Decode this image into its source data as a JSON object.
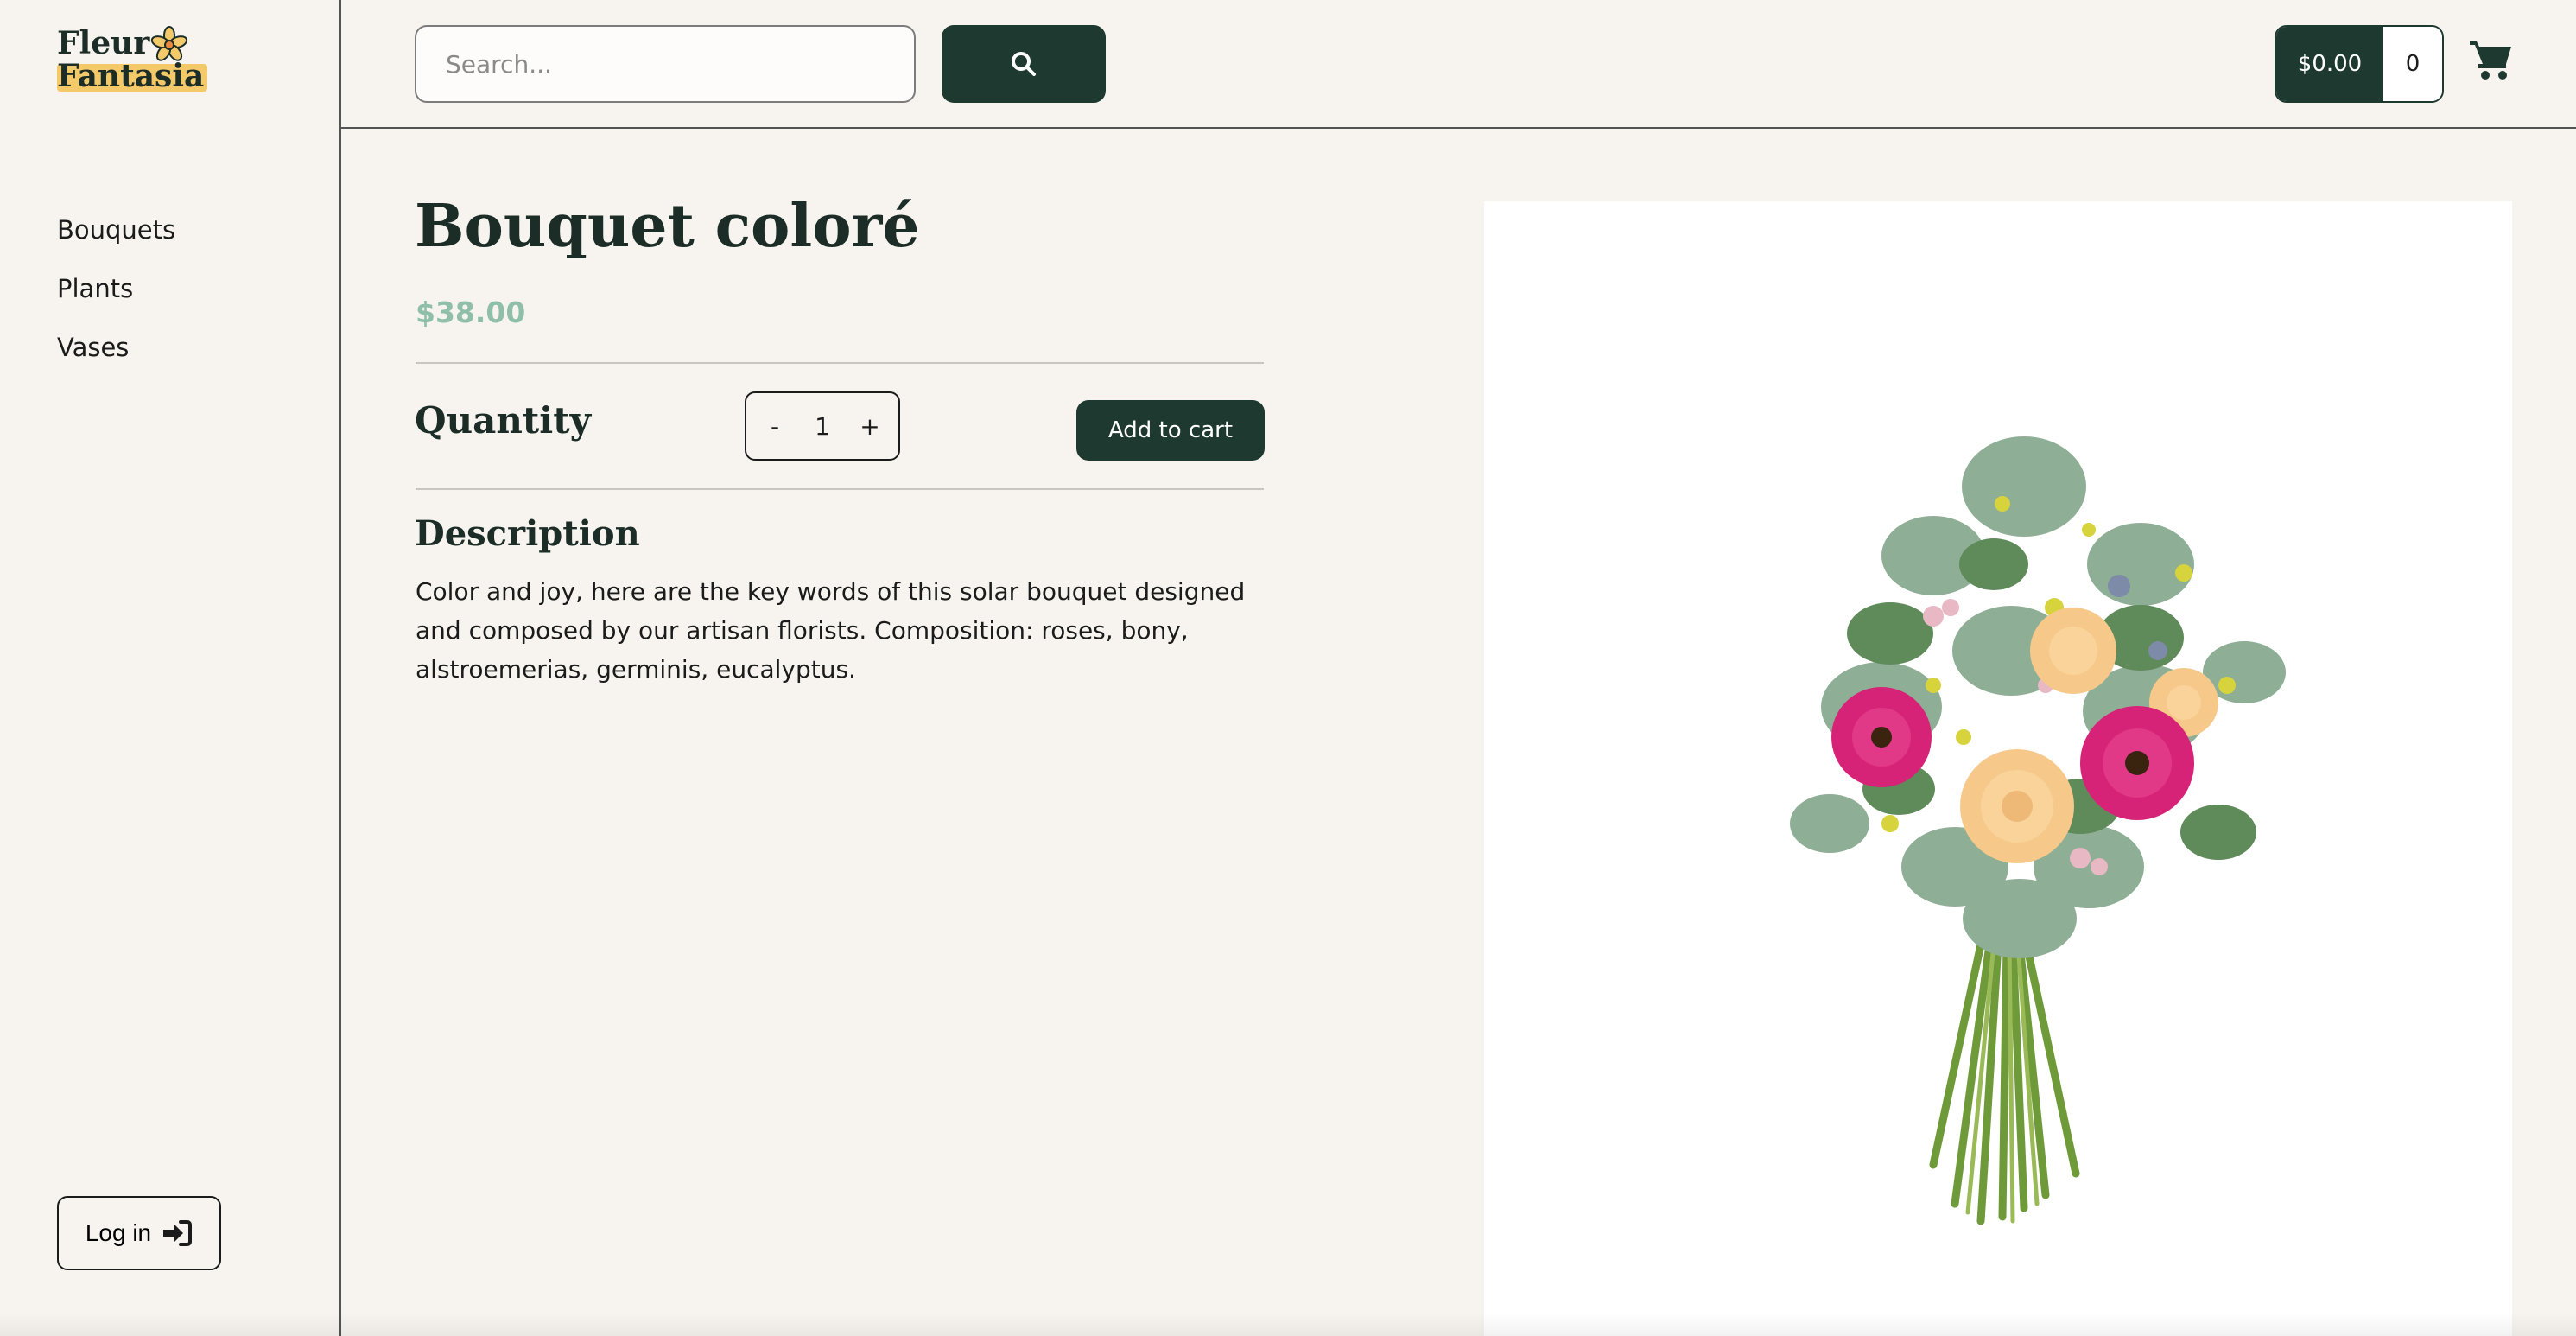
{
  "brand": {
    "line1": "Fleur",
    "line2": "Fantasia"
  },
  "sidebar": {
    "items": [
      {
        "label": "Bouquets"
      },
      {
        "label": "Plants"
      },
      {
        "label": "Vases"
      }
    ],
    "login_label": "Log in"
  },
  "search": {
    "placeholder": "Search...",
    "value": ""
  },
  "cart": {
    "total": "$0.00",
    "count": "0"
  },
  "product": {
    "title": "Bouquet coloré",
    "price": "$38.00",
    "quantity_label": "Quantity",
    "quantity": {
      "decrement": "-",
      "value": "1",
      "increment": "+"
    },
    "add_to_cart_label": "Add to cart",
    "description_title": "Description",
    "description": "Color and joy, here are the key words of this solar bouquet designed and composed by our artisan florists. Composition: roses, bony, alstroemerias, germinis, eucalyptus."
  },
  "colors": {
    "primary": "#1e3a30",
    "price": "#8fbfa8",
    "background": "#f7f4ef",
    "logo_highlight": "#f4c96a"
  },
  "icons": {
    "search_button": "search-icon",
    "cart": "shopping-cart-icon",
    "login": "sign-in-icon",
    "logo_flower": "flower-icon"
  }
}
